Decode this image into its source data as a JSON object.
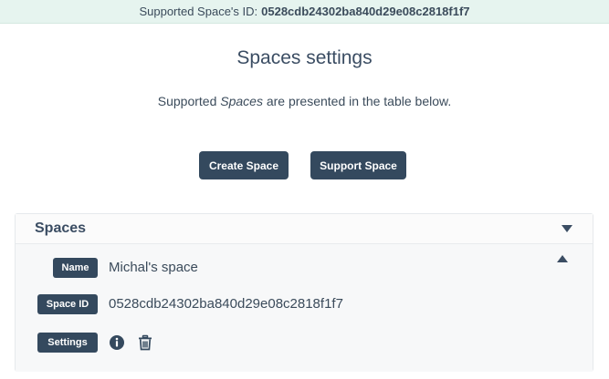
{
  "banner": {
    "prefix": "Supported Space's ID:",
    "space_id": "0528cdb24302ba840d29e08c2818f1f7"
  },
  "page": {
    "title": "Spaces settings",
    "description_before": "Supported ",
    "description_em": "Spaces",
    "description_after": " are presented in the table below."
  },
  "actions": {
    "create_label": "Create Space",
    "support_label": "Support Space"
  },
  "spaces_panel": {
    "title": "Spaces",
    "items": [
      {
        "name_label": "Name",
        "name": "Michal's space",
        "id_label": "Space ID",
        "id": "0528cdb24302ba840d29e08c2818f1f7",
        "settings_label": "Settings",
        "settings_icons": [
          "info-icon",
          "trash-icon"
        ]
      }
    ]
  },
  "colors": {
    "banner_bg": "#e6f4ef",
    "button_bg": "#34495e",
    "text": "#3b4b5b"
  }
}
